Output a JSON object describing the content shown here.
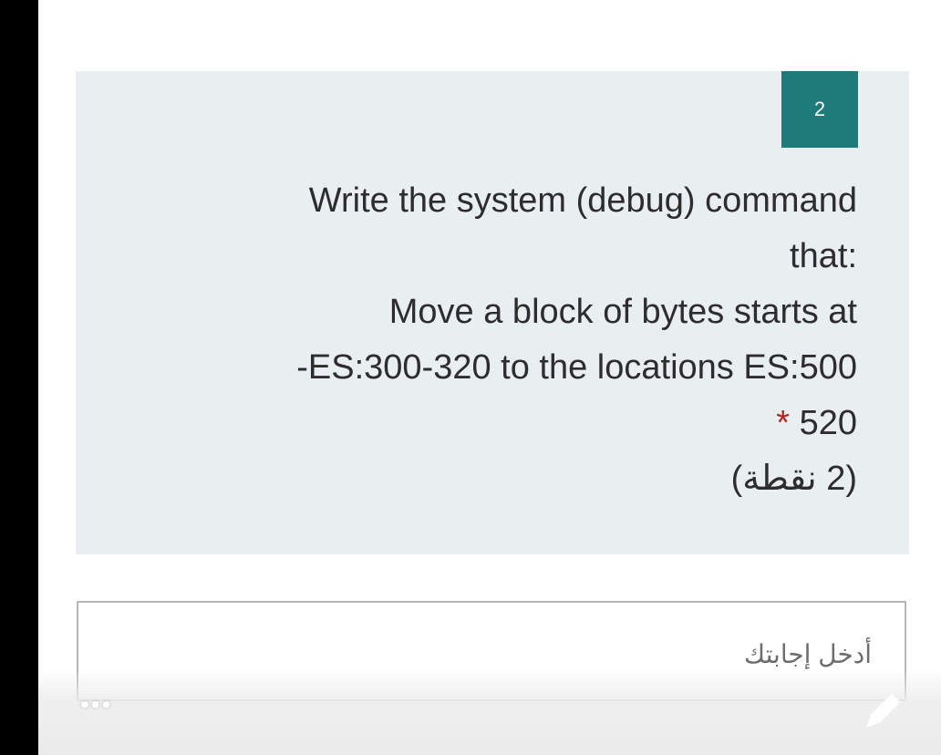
{
  "question": {
    "number": "2",
    "text_lines": [
      "Write the system (debug) command",
      ":that",
      "Move a block of bytes starts at",
      "ES:300-320 to the locations ES:500-",
      "520"
    ],
    "required_marker": "*",
    "points": "(2 نقطة)"
  },
  "answer": {
    "placeholder": "أدخل إجابتك"
  },
  "icons": {
    "more": "more-horizontal-icon",
    "edit": "pencil-icon"
  },
  "colors": {
    "card_bg": "#e9eef1",
    "number_badge": "#1f7a7a",
    "required": "#b3261e"
  }
}
